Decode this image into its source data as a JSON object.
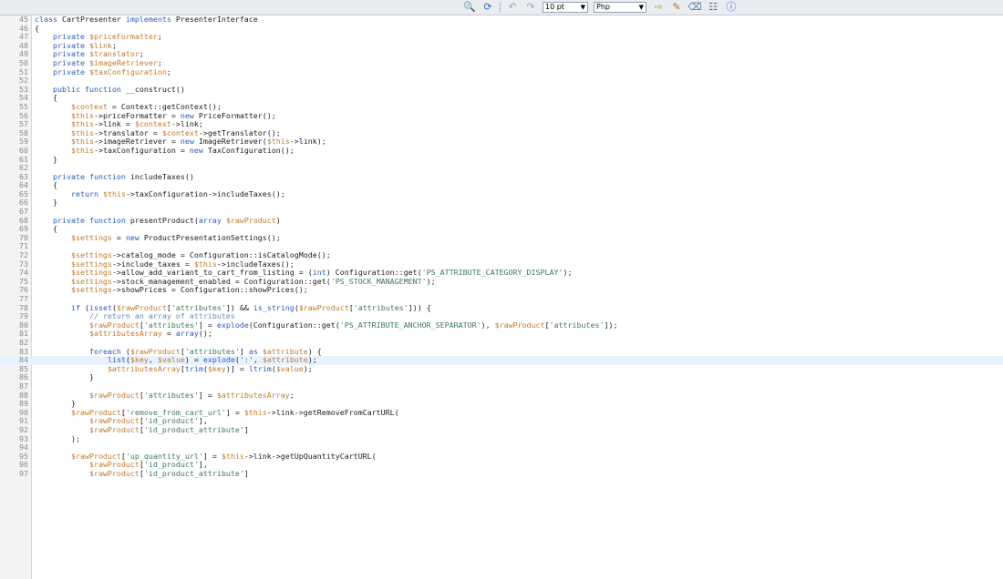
{
  "toolbar": {
    "font_size": "10 pt",
    "language": "Php",
    "buttons": [
      "binoculars-icon",
      "refresh-icon",
      "undo-icon",
      "redo-icon",
      "arrow-icon",
      "highlight-icon",
      "erase-icon",
      "settings-icon",
      "help-icon"
    ]
  },
  "editor": {
    "highlighted_line": 84,
    "lines": [
      {
        "n": "45",
        "t": "class CartPresenter implements PresenterInterface"
      },
      {
        "n": "46",
        "t": "{"
      },
      {
        "n": "47",
        "t": "    private $priceFormatter;"
      },
      {
        "n": "48",
        "t": "    private $link;"
      },
      {
        "n": "49",
        "t": "    private $translator;"
      },
      {
        "n": "50",
        "t": "    private $imageRetriever;"
      },
      {
        "n": "51",
        "t": "    private $taxConfiguration;"
      },
      {
        "n": "52",
        "t": ""
      },
      {
        "n": "53",
        "t": "    public function __construct()"
      },
      {
        "n": "54",
        "t": "    {"
      },
      {
        "n": "55",
        "t": "        $context = Context::getContext();"
      },
      {
        "n": "56",
        "t": "        $this->priceFormatter = new PriceFormatter();"
      },
      {
        "n": "57",
        "t": "        $this->link = $context->link;"
      },
      {
        "n": "58",
        "t": "        $this->translator = $context->getTranslator();"
      },
      {
        "n": "59",
        "t": "        $this->imageRetriever = new ImageRetriever($this->link);"
      },
      {
        "n": "60",
        "t": "        $this->taxConfiguration = new TaxConfiguration();"
      },
      {
        "n": "61",
        "t": "    }"
      },
      {
        "n": "62",
        "t": ""
      },
      {
        "n": "63",
        "t": "    private function includeTaxes()"
      },
      {
        "n": "64",
        "t": "    {"
      },
      {
        "n": "65",
        "t": "        return $this->taxConfiguration->includeTaxes();"
      },
      {
        "n": "66",
        "t": "    }"
      },
      {
        "n": "67",
        "t": ""
      },
      {
        "n": "68",
        "t": "    private function presentProduct(array $rawProduct)"
      },
      {
        "n": "69",
        "t": "    {"
      },
      {
        "n": "70",
        "t": "        $settings = new ProductPresentationSettings();"
      },
      {
        "n": "71",
        "t": ""
      },
      {
        "n": "72",
        "t": "        $settings->catalog_mode = Configuration::isCatalogMode();"
      },
      {
        "n": "73",
        "t": "        $settings->include_taxes = $this->includeTaxes();"
      },
      {
        "n": "74",
        "t": "        $settings->allow_add_variant_to_cart_from_listing = (int) Configuration::get('PS_ATTRIBUTE_CATEGORY_DISPLAY');"
      },
      {
        "n": "75",
        "t": "        $settings->stock_management_enabled = Configuration::get('PS_STOCK_MANAGEMENT');"
      },
      {
        "n": "76",
        "t": "        $settings->showPrices = Configuration::showPrices();"
      },
      {
        "n": "77",
        "t": ""
      },
      {
        "n": "78",
        "t": "        if (isset($rawProduct['attributes']) && is_string($rawProduct['attributes'])) {"
      },
      {
        "n": "79",
        "t": "            // return an array of attributes"
      },
      {
        "n": "80",
        "t": "            $rawProduct['attributes'] = explode(Configuration::get('PS_ATTRIBUTE_ANCHOR_SEPARATOR'), $rawProduct['attributes']);"
      },
      {
        "n": "81",
        "t": "            $attributesArray = array();"
      },
      {
        "n": "82",
        "t": ""
      },
      {
        "n": "83",
        "t": "            foreach ($rawProduct['attributes'] as $attribute) {"
      },
      {
        "n": "84",
        "t": "                list($key, $value) = explode(':', $attribute);"
      },
      {
        "n": "85",
        "t": "                $attributesArray[trim($key)] = ltrim($value);"
      },
      {
        "n": "86",
        "t": "            }"
      },
      {
        "n": "87",
        "t": ""
      },
      {
        "n": "88",
        "t": "            $rawProduct['attributes'] = $attributesArray;"
      },
      {
        "n": "89",
        "t": "        }"
      },
      {
        "n": "90",
        "t": "        $rawProduct['remove_from_cart_url'] = $this->link->getRemoveFromCartURL("
      },
      {
        "n": "91",
        "t": "            $rawProduct['id_product'],"
      },
      {
        "n": "92",
        "t": "            $rawProduct['id_product_attribute']"
      },
      {
        "n": "93",
        "t": "        );"
      },
      {
        "n": "94",
        "t": ""
      },
      {
        "n": "95",
        "t": "        $rawProduct['up_quantity_url'] = $this->link->getUpQuantityCartURL("
      },
      {
        "n": "96",
        "t": "            $rawProduct['id_product'],"
      },
      {
        "n": "97",
        "t": "            $rawProduct['id_product_attribute']"
      }
    ]
  }
}
